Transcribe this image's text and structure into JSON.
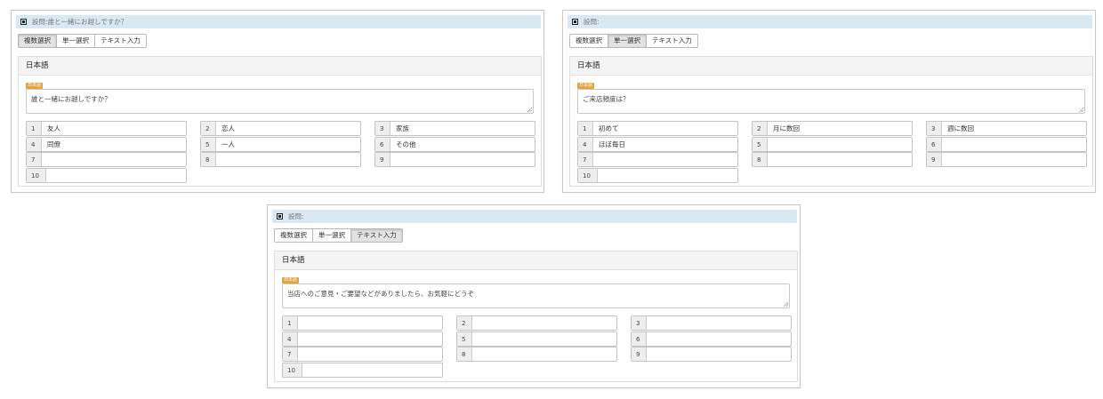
{
  "tabs": [
    "複数選択",
    "単一選択",
    "テキスト入力"
  ],
  "lang_label": "日本語",
  "lang_badge": "日本語",
  "panels": [
    {
      "header_title": "設問:誰と一緒にお越しですか？",
      "active_tab": "複数選択",
      "question_text": "誰と一緒にお越しですか？",
      "options": [
        {
          "num": "1",
          "value": "友人"
        },
        {
          "num": "2",
          "value": "恋人"
        },
        {
          "num": "3",
          "value": "家族"
        },
        {
          "num": "4",
          "value": "同僚"
        },
        {
          "num": "5",
          "value": "一人"
        },
        {
          "num": "6",
          "value": "その他"
        },
        {
          "num": "7",
          "value": ""
        },
        {
          "num": "8",
          "value": ""
        },
        {
          "num": "9",
          "value": ""
        },
        {
          "num": "10",
          "value": ""
        }
      ]
    },
    {
      "header_title": "設問:",
      "active_tab": "単一選択",
      "question_text": "ご来店頻度は？",
      "options": [
        {
          "num": "1",
          "value": "初めて"
        },
        {
          "num": "2",
          "value": "月に数回"
        },
        {
          "num": "3",
          "value": "週に数回"
        },
        {
          "num": "4",
          "value": "ほぼ毎日"
        },
        {
          "num": "5",
          "value": ""
        },
        {
          "num": "6",
          "value": ""
        },
        {
          "num": "7",
          "value": ""
        },
        {
          "num": "8",
          "value": ""
        },
        {
          "num": "9",
          "value": ""
        },
        {
          "num": "10",
          "value": ""
        }
      ]
    },
    {
      "header_title": "設問:",
      "active_tab": "テキスト入力",
      "question_text": "当店へのご意見・ご要望などがありましたら、お気軽にどうぞ",
      "options": [
        {
          "num": "1",
          "value": ""
        },
        {
          "num": "2",
          "value": ""
        },
        {
          "num": "3",
          "value": ""
        },
        {
          "num": "4",
          "value": ""
        },
        {
          "num": "5",
          "value": ""
        },
        {
          "num": "6",
          "value": ""
        },
        {
          "num": "7",
          "value": ""
        },
        {
          "num": "8",
          "value": ""
        },
        {
          "num": "9",
          "value": ""
        },
        {
          "num": "10",
          "value": ""
        }
      ]
    }
  ]
}
